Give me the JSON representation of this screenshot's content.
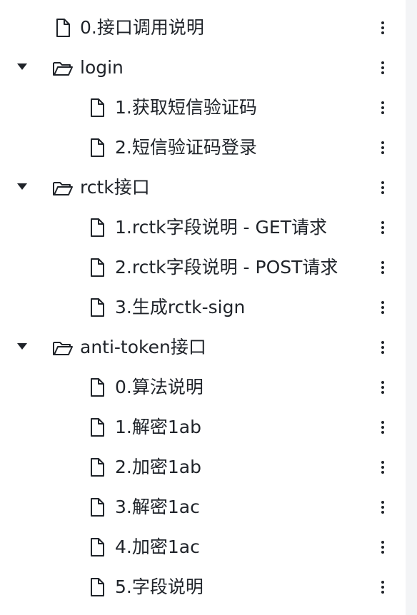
{
  "tree": {
    "items": [
      {
        "label": "0.接口调用说明",
        "type": "file",
        "level": 0
      },
      {
        "label": "login",
        "type": "folder",
        "level": 0,
        "expanded": true
      },
      {
        "label": "1.获取短信验证码",
        "type": "file",
        "level": 1
      },
      {
        "label": "2.短信验证码登录",
        "type": "file",
        "level": 1
      },
      {
        "label": "rctk接口",
        "type": "folder",
        "level": 0,
        "expanded": true
      },
      {
        "label": "1.rctk字段说明 - GET请求",
        "type": "file",
        "level": 1
      },
      {
        "label": "2.rctk字段说明 - POST请求",
        "type": "file",
        "level": 1
      },
      {
        "label": "3.生成rctk-sign",
        "type": "file",
        "level": 1
      },
      {
        "label": "anti-token接口",
        "type": "folder",
        "level": 0,
        "expanded": true
      },
      {
        "label": "0.算法说明",
        "type": "file",
        "level": 1
      },
      {
        "label": "1.解密1ab",
        "type": "file",
        "level": 1
      },
      {
        "label": "2.加密1ab",
        "type": "file",
        "level": 1
      },
      {
        "label": "3.解密1ac",
        "type": "file",
        "level": 1
      },
      {
        "label": "4.加密1ac",
        "type": "file",
        "level": 1
      },
      {
        "label": "5.字段说明",
        "type": "file",
        "level": 1
      }
    ]
  },
  "icons": {
    "file": "file-icon",
    "folder": "folder-open-icon",
    "expand": "caret-down-icon",
    "more": "more-vertical-icon"
  },
  "colors": {
    "text": "#1f2329",
    "background": "#ffffff"
  }
}
